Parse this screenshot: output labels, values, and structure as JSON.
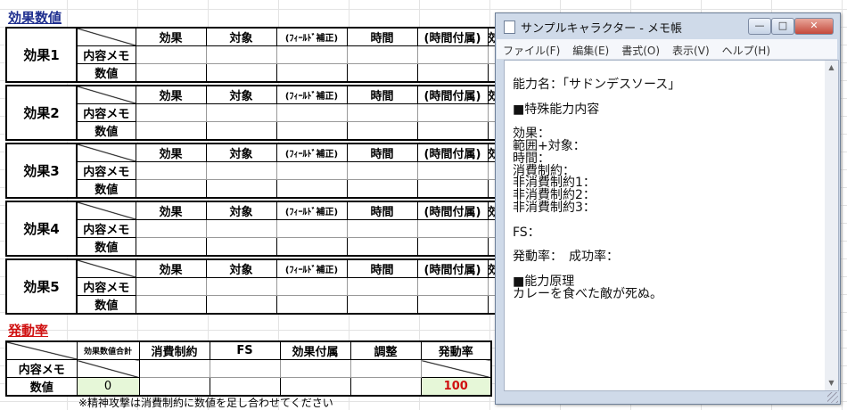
{
  "sheet": {
    "title_effects": "効果数値",
    "title_rate": "発動率",
    "effect_headers": [
      "効果",
      "対象",
      "(ﾌｨｰﾙﾄﾞ補正)",
      "時間",
      "(時間付属)"
    ],
    "effect_overflow": "効",
    "row_memo": "内容メモ",
    "row_value": "数値",
    "effects": [
      {
        "label": "効果1"
      },
      {
        "label": "効果2"
      },
      {
        "label": "効果3"
      },
      {
        "label": "効果4"
      },
      {
        "label": "効果5"
      }
    ],
    "rate_headers": [
      "効果数値合計",
      "消費制約",
      "FS",
      "効果付属",
      "調整",
      "発動率"
    ],
    "rate_values": {
      "total": "0",
      "rate": "100"
    },
    "note": "※精神攻撃は消費制約に数値を足し合わせてください",
    "colors": {
      "title_blue": "#1f2f8f",
      "title_red": "#d01010",
      "input_green": "#e6f7d8"
    }
  },
  "notepad": {
    "title": "サンプルキャラクター - メモ帳",
    "menu": [
      "ファイル(F)",
      "編集(E)",
      "書式(O)",
      "表示(V)",
      "ヘルプ(H)"
    ],
    "buttons": {
      "minimize": "—",
      "maximize": "□",
      "close": "✕"
    },
    "content": "能力名：「サドンデスソース」\n\n■特殊能力内容\n\n効果：\n範囲+対象：\n時間：\n消費制約：\n非消費制約1：\n非消費制約2：\n非消費制約3：\n\nFS：\n\n発動率：　成功率：\n\n■能力原理\nカレーを食べた敵が死ぬ。"
  }
}
